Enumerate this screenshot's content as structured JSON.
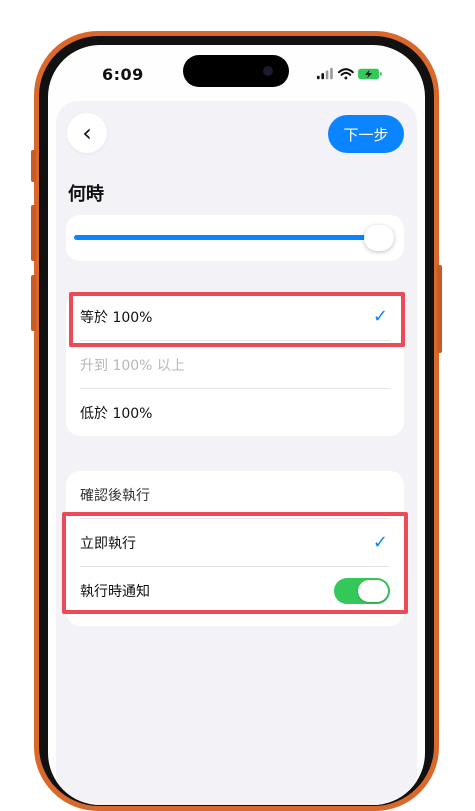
{
  "status_bar": {
    "time": "6:09",
    "icons": [
      "signal-icon",
      "wifi-icon",
      "battery-charging-icon"
    ]
  },
  "nav": {
    "back_icon": "chevron-left-icon",
    "next_label": "下一步"
  },
  "section_title": "何時",
  "slider": {
    "value_percent": 100
  },
  "condition_options": [
    {
      "label": "等於 100%",
      "selected": true,
      "enabled": true
    },
    {
      "label": "升到 100% 以上",
      "selected": false,
      "enabled": false
    },
    {
      "label": "低於 100%",
      "selected": false,
      "enabled": true
    }
  ],
  "run_group": {
    "header": "確認後執行",
    "run_immediately_label": "立即執行",
    "run_immediately_selected": true,
    "notify_label": "執行時通知",
    "notify_on": true
  },
  "colors": {
    "accent": "#0a84ff",
    "toggle_on": "#34c759",
    "highlight": "#ea4b56",
    "phone_frame": "#d9682b"
  }
}
